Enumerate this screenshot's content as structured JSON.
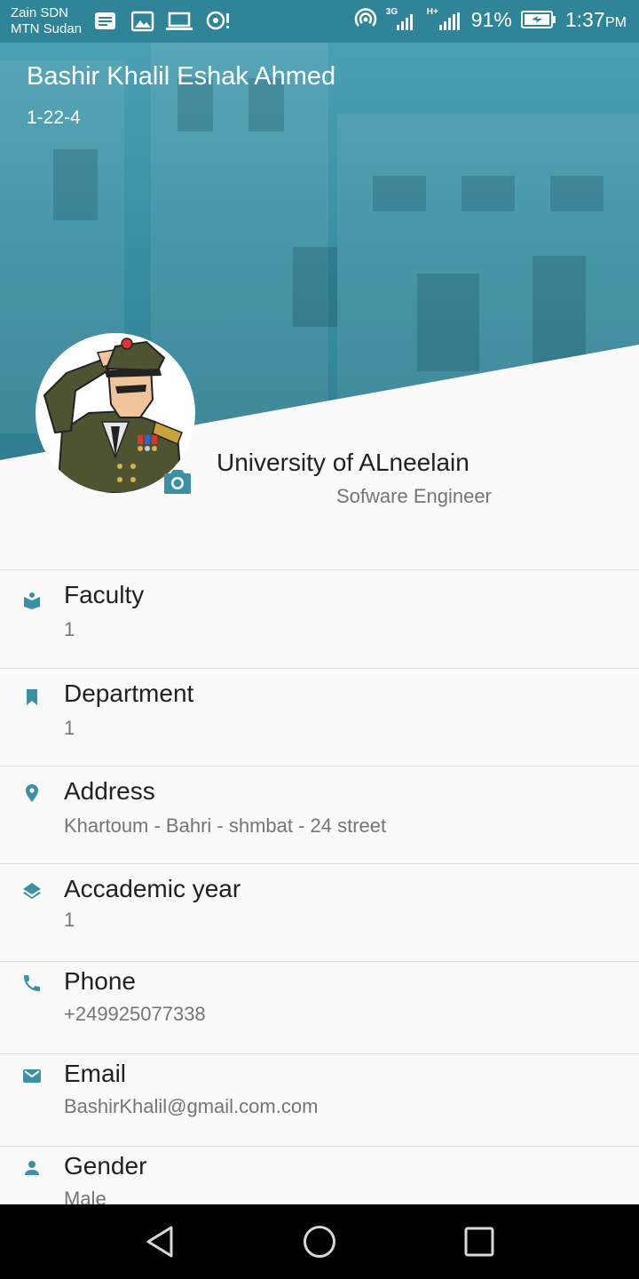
{
  "status_bar": {
    "carrier_1": "Zain SDN",
    "carrier_2": "MTN Sudan",
    "network_1": "3G",
    "network_2": "H+",
    "battery": "91%",
    "time": "1:37",
    "ampm": "PM"
  },
  "profile": {
    "name": "Bashir Khalil Eshak Ahmed",
    "id": "1-22-4",
    "university": "University of ALneelain",
    "job": "Sofware Engineer",
    "avatar_icon": "soldier-saluting-avatar",
    "camera_icon": "camera-icon"
  },
  "info": [
    {
      "label": "Faculty",
      "value": "1",
      "icon": "book-icon"
    },
    {
      "label": "Department",
      "value": "1",
      "icon": "bookmark-icon"
    },
    {
      "label": "Address",
      "value": "Khartoum - Bahri -  shmbat - 24 street",
      "icon": "location-pin-icon"
    },
    {
      "label": "Accademic year",
      "value": "1",
      "icon": "layers-icon"
    },
    {
      "label": "Phone",
      "value": "+249925077338",
      "icon": "phone-icon"
    },
    {
      "label": "Email",
      "value": "BashirKhalil@gmail.com.com",
      "icon": "mail-icon"
    },
    {
      "label": "Gender",
      "value": "Male",
      "icon": "person-icon"
    }
  ],
  "colors": {
    "accent": "#2f8497",
    "icon": "#3d8fa3"
  }
}
